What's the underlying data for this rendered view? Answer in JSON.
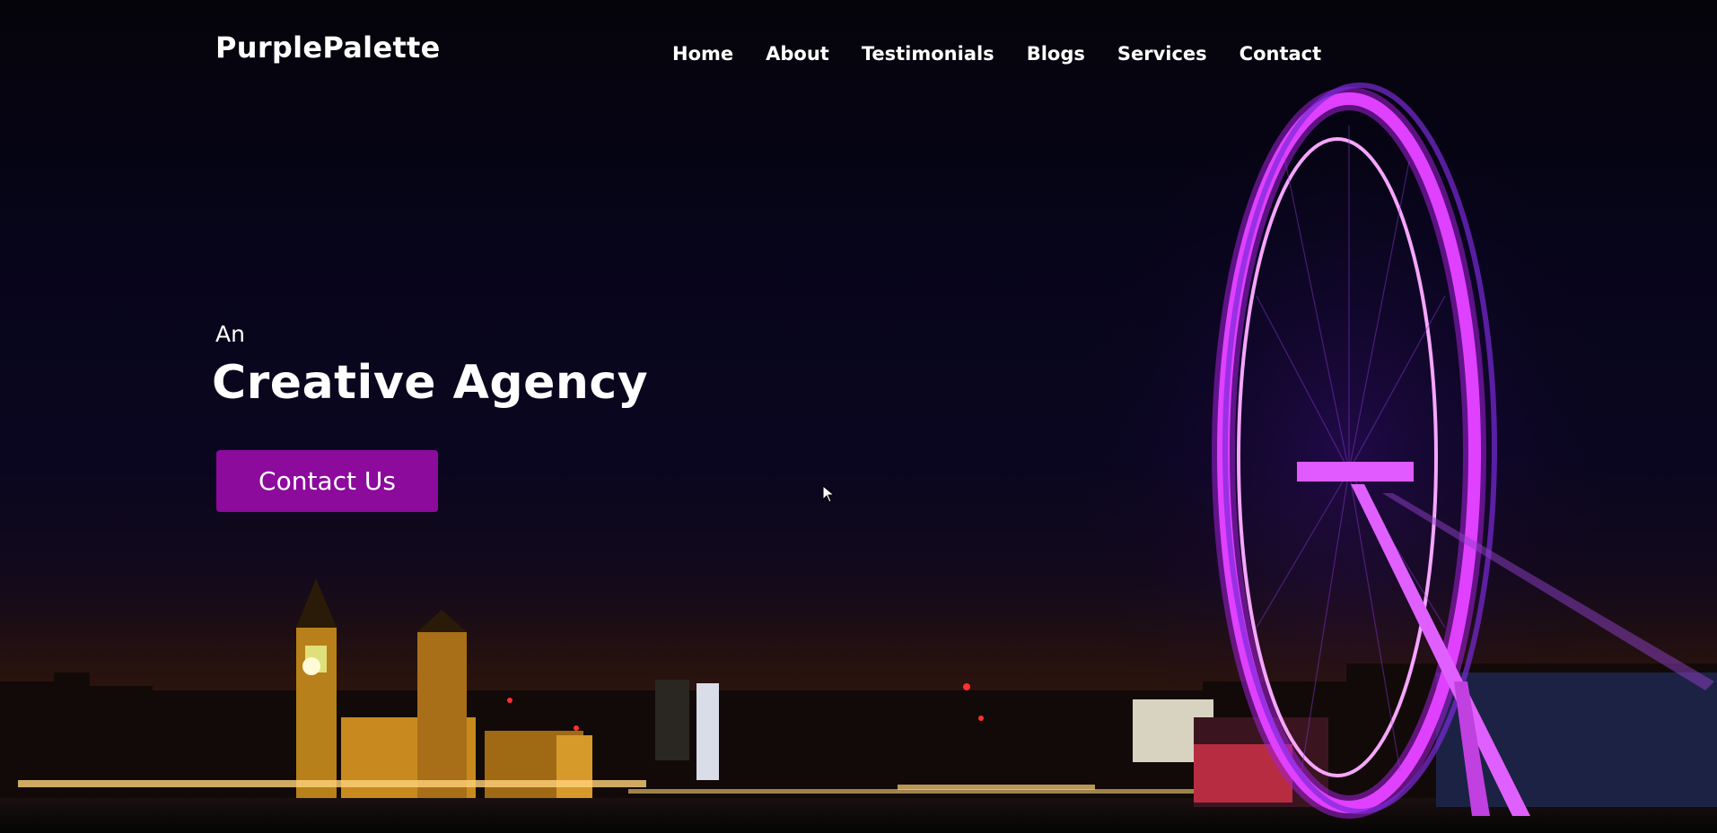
{
  "brand": {
    "logo": "PurplePalette"
  },
  "nav": {
    "items": [
      {
        "label": "Home"
      },
      {
        "label": "About"
      },
      {
        "label": "Testimonials"
      },
      {
        "label": "Blogs"
      },
      {
        "label": "Services"
      },
      {
        "label": "Contact"
      }
    ]
  },
  "hero": {
    "pretitle": "An",
    "title": "Creative Agency",
    "cta_label": "Contact Us",
    "background": "night-city-skyline-with-ferris-wheel"
  },
  "colors": {
    "accent": "#8c0a9c",
    "wheel": "#e040ff",
    "text": "#ffffff"
  }
}
